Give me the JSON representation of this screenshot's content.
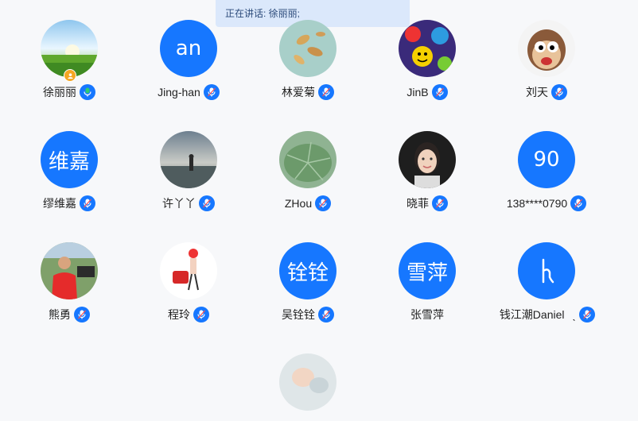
{
  "banner": {
    "speaking_text": "正在讲话: 徐丽丽;"
  },
  "colors": {
    "accent": "#1677ff",
    "banner_bg": "#dbe8fb",
    "host_badge": "#f5a623",
    "active_mic": "#2ecc71"
  },
  "participants": [
    {
      "name": "徐丽丽",
      "avatar_type": "photo",
      "avatar_hint": "meadow-sky",
      "host": true,
      "speaking": true
    },
    {
      "name": "Jing-han",
      "avatar_type": "text",
      "avatar_text": "an"
    },
    {
      "name": "林爱菊",
      "avatar_type": "photo",
      "avatar_hint": "leaves"
    },
    {
      "name": "JinB",
      "avatar_type": "photo",
      "avatar_hint": "cartoon-collage"
    },
    {
      "name": "刘天",
      "avatar_type": "photo",
      "avatar_hint": "cartoon-monkey"
    },
    {
      "name": "缪维嘉",
      "avatar_type": "text",
      "avatar_text": "维嘉"
    },
    {
      "name": "许丫丫",
      "avatar_type": "photo",
      "avatar_hint": "beach-sunset"
    },
    {
      "name": "ZHou",
      "avatar_type": "photo",
      "avatar_hint": "lotus-leaf"
    },
    {
      "name": "晓菲",
      "avatar_type": "photo",
      "avatar_hint": "woman-portrait"
    },
    {
      "name": "138****0790",
      "avatar_type": "text",
      "avatar_text": "90"
    },
    {
      "name": "熊勇",
      "avatar_type": "photo",
      "avatar_hint": "man-red-shirt"
    },
    {
      "name": "程玲",
      "avatar_type": "photo",
      "avatar_hint": "girl-red-bag"
    },
    {
      "name": "吴铨铨",
      "avatar_type": "text",
      "avatar_text": "铨铨"
    },
    {
      "name": "张雪萍",
      "avatar_type": "text",
      "avatar_text": "雪萍"
    },
    {
      "name": "钱江潮Daniel",
      "avatar_type": "text",
      "avatar_text": "ʰ"
    },
    {
      "name": "",
      "avatar_type": "photo",
      "avatar_hint": "partial-baby"
    }
  ]
}
